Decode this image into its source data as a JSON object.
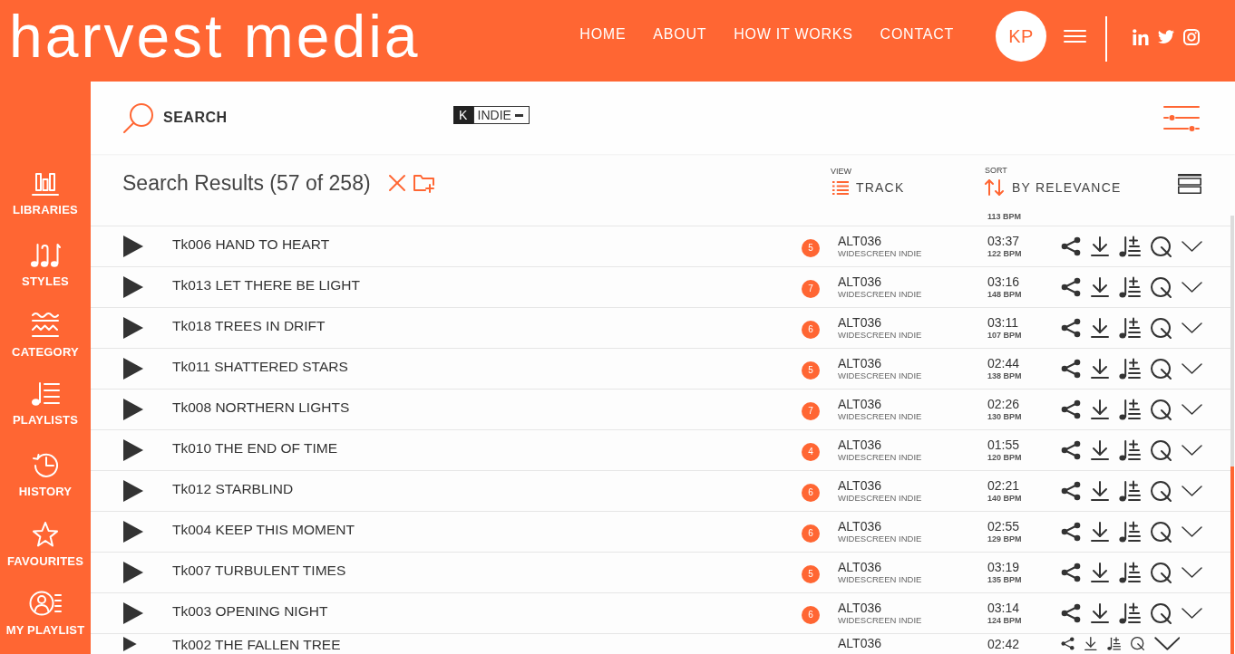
{
  "header": {
    "logo": "harvest media",
    "nav": [
      {
        "label": "HOME"
      },
      {
        "label": "ABOUT"
      },
      {
        "label": "HOW IT WORKS"
      },
      {
        "label": "CONTACT"
      }
    ],
    "avatar": "KP"
  },
  "sidebar": {
    "items": [
      {
        "label": "LIBRARIES"
      },
      {
        "label": "STYLES"
      },
      {
        "label": "CATEGORY"
      },
      {
        "label": "PLAYLISTS"
      },
      {
        "label": "HISTORY"
      },
      {
        "label": "FAVOURITES"
      },
      {
        "label": "MY PLAYLIST"
      }
    ]
  },
  "search": {
    "label": "SEARCH",
    "tags": [
      {
        "key": "K",
        "label": "INDIE"
      }
    ]
  },
  "results": {
    "title": "Search Results (57 of 258)",
    "view": {
      "caption": "VIEW",
      "value": "TRACK"
    },
    "sort": {
      "caption": "SORT",
      "value": "BY RELEVANCE"
    }
  },
  "tracks": [
    {
      "kind": "partial",
      "bpm": "113 BPM"
    },
    {
      "kind": "full",
      "title": "Tk006 HAND TO HEART",
      "rating": "5",
      "code": "ALT036",
      "library": "WIDESCREEN INDIE",
      "duration": "03:37",
      "bpm": "122 BPM"
    },
    {
      "kind": "full",
      "title": "Tk013 LET THERE BE LIGHT",
      "rating": "7",
      "code": "ALT036",
      "library": "WIDESCREEN INDIE",
      "duration": "03:16",
      "bpm": "148 BPM"
    },
    {
      "kind": "full",
      "title": "Tk018 TREES IN DRIFT",
      "rating": "6",
      "code": "ALT036",
      "library": "WIDESCREEN INDIE",
      "duration": "03:11",
      "bpm": "107 BPM"
    },
    {
      "kind": "full",
      "title": "Tk011 SHATTERED STARS",
      "rating": "5",
      "code": "ALT036",
      "library": "WIDESCREEN INDIE",
      "duration": "02:44",
      "bpm": "138 BPM"
    },
    {
      "kind": "full",
      "title": "Tk008 NORTHERN LIGHTS",
      "rating": "7",
      "code": "ALT036",
      "library": "WIDESCREEN INDIE",
      "duration": "02:26",
      "bpm": "130 BPM"
    },
    {
      "kind": "full",
      "title": "Tk010 THE END OF TIME",
      "rating": "4",
      "code": "ALT036",
      "library": "WIDESCREEN INDIE",
      "duration": "01:55",
      "bpm": "120 BPM"
    },
    {
      "kind": "full",
      "title": "Tk012 STARBLIND",
      "rating": "6",
      "code": "ALT036",
      "library": "WIDESCREEN INDIE",
      "duration": "02:21",
      "bpm": "140 BPM"
    },
    {
      "kind": "full",
      "title": "Tk004 KEEP THIS MOMENT",
      "rating": "6",
      "code": "ALT036",
      "library": "WIDESCREEN INDIE",
      "duration": "02:55",
      "bpm": "129 BPM"
    },
    {
      "kind": "full",
      "title": "Tk007 TURBULENT TIMES",
      "rating": "5",
      "code": "ALT036",
      "library": "WIDESCREEN INDIE",
      "duration": "03:19",
      "bpm": "135 BPM"
    },
    {
      "kind": "full",
      "title": "Tk003 OPENING NIGHT",
      "rating": "6",
      "code": "ALT036",
      "library": "WIDESCREEN INDIE",
      "duration": "03:14",
      "bpm": "124 BPM"
    },
    {
      "kind": "cut",
      "title": "Tk002 THE FALLEN TREE",
      "code": "ALT036",
      "duration": "02:42"
    }
  ]
}
